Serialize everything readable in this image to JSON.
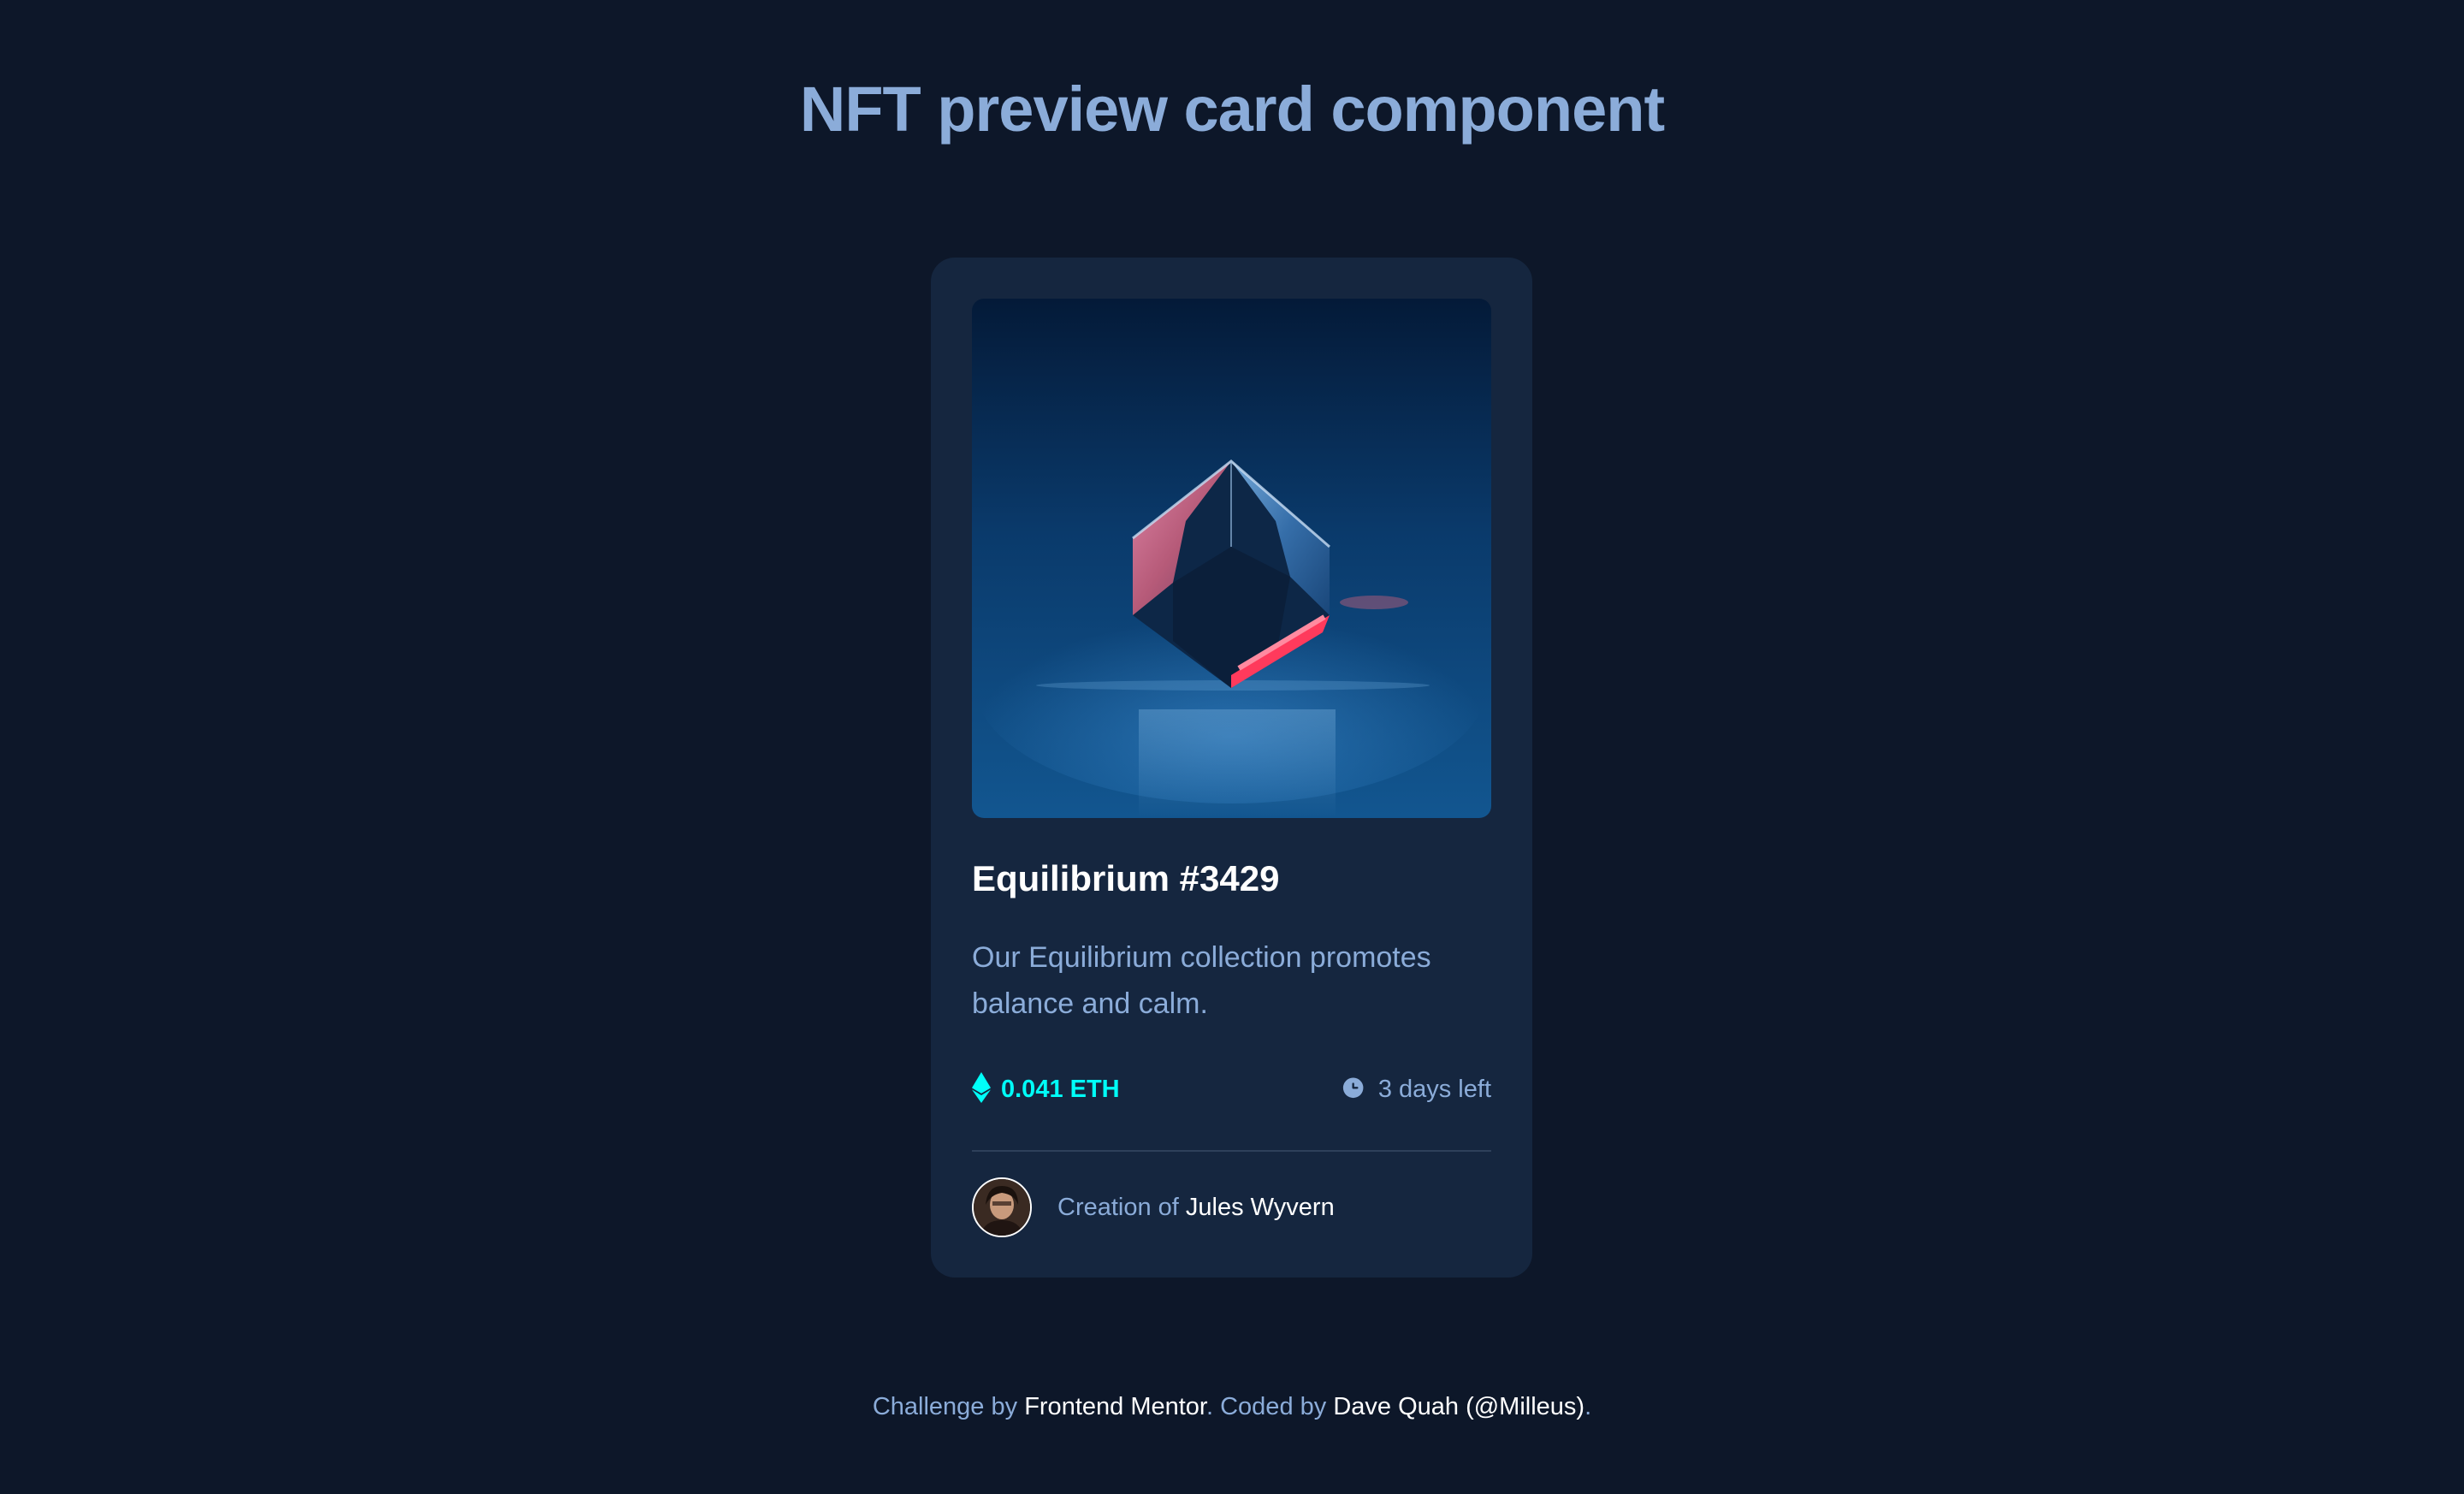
{
  "page": {
    "title": "NFT preview card component"
  },
  "card": {
    "image_alt": "Equilibrium",
    "title": "Equilibrium #3429",
    "description": "Our Equilibrium collection promotes balance and calm.",
    "price": "0.041 ETH",
    "price_icon": "ethereum-icon",
    "time_left": "3 days left",
    "time_icon": "clock-icon",
    "creator_prefix": "Creation of",
    "creator_name": "Jules Wyvern"
  },
  "footer": {
    "challenge_prefix": "Challenge by",
    "challenge_link": "Frontend Mentor",
    "period1": ".",
    "coded_prefix": "Coded by",
    "coder_link": "Dave Quah (@Milleus)",
    "period2": "."
  },
  "colors": {
    "background": "#0d1729",
    "card": "#15263f",
    "accent_cyan": "#00fff8",
    "soft_blue": "#8bacd9",
    "white": "#ffffff"
  }
}
